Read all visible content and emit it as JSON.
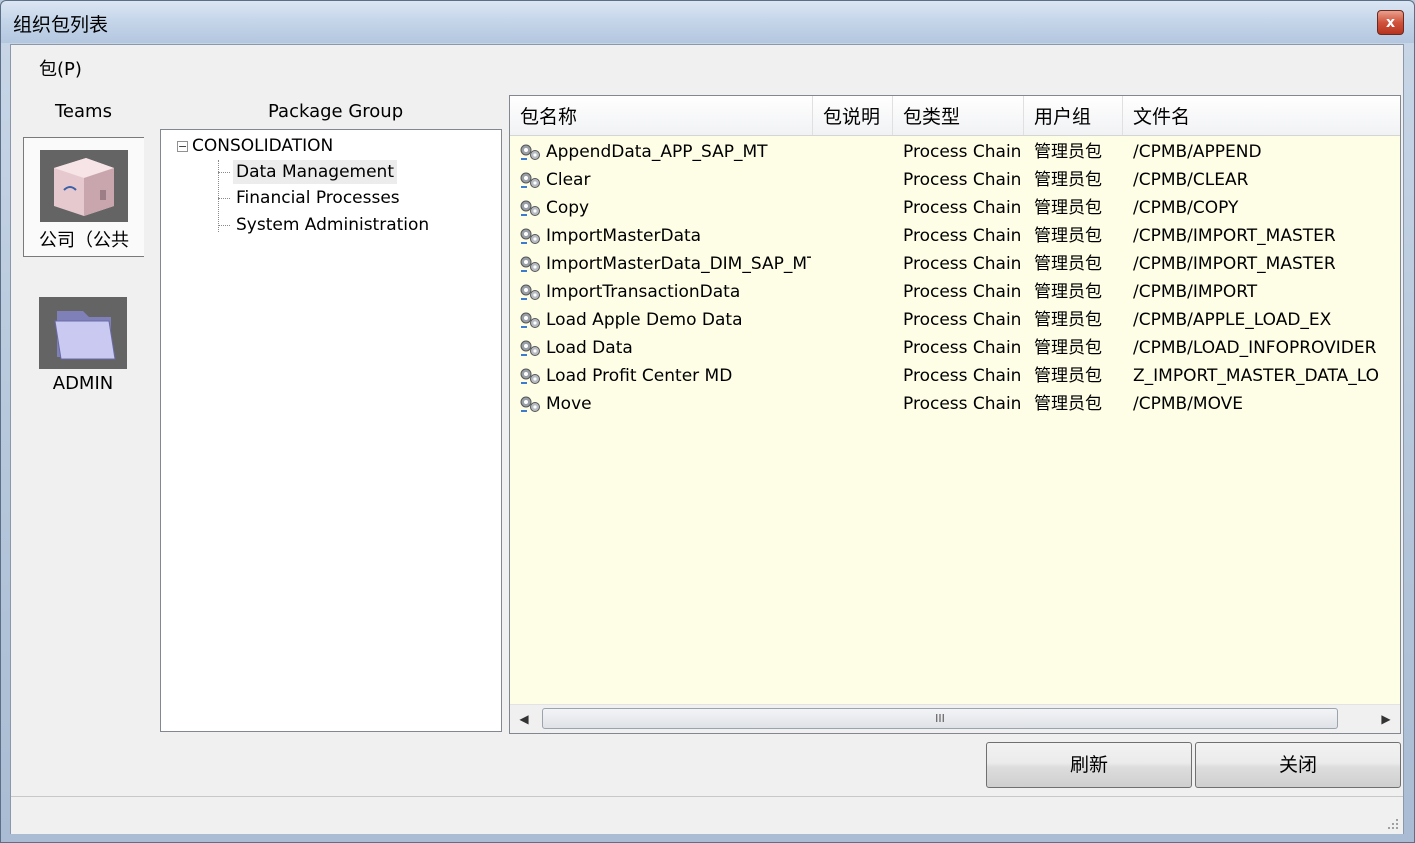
{
  "window": {
    "title": "组织包列表",
    "close_glyph": "x"
  },
  "menu": {
    "package_label": "包(P)"
  },
  "teams": {
    "header": "Teams",
    "items": [
      {
        "label": "公司（公共",
        "icon": "company-server-icon",
        "selected": true
      },
      {
        "label": "ADMIN",
        "icon": "folder-icon",
        "selected": false
      }
    ]
  },
  "package_group": {
    "header": "Package Group",
    "root": {
      "label": "CONSOLIDATION",
      "expander": "−"
    },
    "children": [
      {
        "label": "Data Management",
        "selected": true
      },
      {
        "label": "Financial Processes",
        "selected": false
      },
      {
        "label": "System Administration",
        "selected": false
      }
    ]
  },
  "package_list": {
    "columns": [
      "包名称",
      "包说明",
      "包类型",
      "用户组",
      "文件名"
    ],
    "rows": [
      {
        "name": "AppendData_APP_SAP_MT",
        "desc": "",
        "type": "Process Chain",
        "group": "管理员包",
        "file": "/CPMB/APPEND"
      },
      {
        "name": "Clear",
        "desc": "",
        "type": "Process Chain",
        "group": "管理员包",
        "file": "/CPMB/CLEAR"
      },
      {
        "name": "Copy",
        "desc": "",
        "type": "Process Chain",
        "group": "管理员包",
        "file": "/CPMB/COPY"
      },
      {
        "name": "ImportMasterData",
        "desc": "",
        "type": "Process Chain",
        "group": "管理员包",
        "file": "/CPMB/IMPORT_MASTER"
      },
      {
        "name": "ImportMasterData_DIM_SAP_MT",
        "desc": "",
        "type": "Process Chain",
        "group": "管理员包",
        "file": "/CPMB/IMPORT_MASTER"
      },
      {
        "name": "ImportTransactionData",
        "desc": "",
        "type": "Process Chain",
        "group": "管理员包",
        "file": "/CPMB/IMPORT"
      },
      {
        "name": "Load Apple Demo Data",
        "desc": "",
        "type": "Process Chain",
        "group": "管理员包",
        "file": "/CPMB/APPLE_LOAD_EX"
      },
      {
        "name": "Load Data",
        "desc": "",
        "type": "Process Chain",
        "group": "管理员包",
        "file": "/CPMB/LOAD_INFOPROVIDER"
      },
      {
        "name": "Load Profit Center MD",
        "desc": "",
        "type": "Process Chain",
        "group": "管理员包",
        "file": "Z_IMPORT_MASTER_DATA_LO"
      },
      {
        "name": "Move",
        "desc": "",
        "type": "Process Chain",
        "group": "管理员包",
        "file": "/CPMB/MOVE"
      }
    ],
    "scroll": {
      "left_arrow": "◀",
      "right_arrow": "▶",
      "thumb_grip": "III"
    }
  },
  "buttons": {
    "refresh": "刷新",
    "close": "关闭"
  },
  "colors": {
    "list_background": "#fefde6",
    "close_button": "#c9432c"
  }
}
